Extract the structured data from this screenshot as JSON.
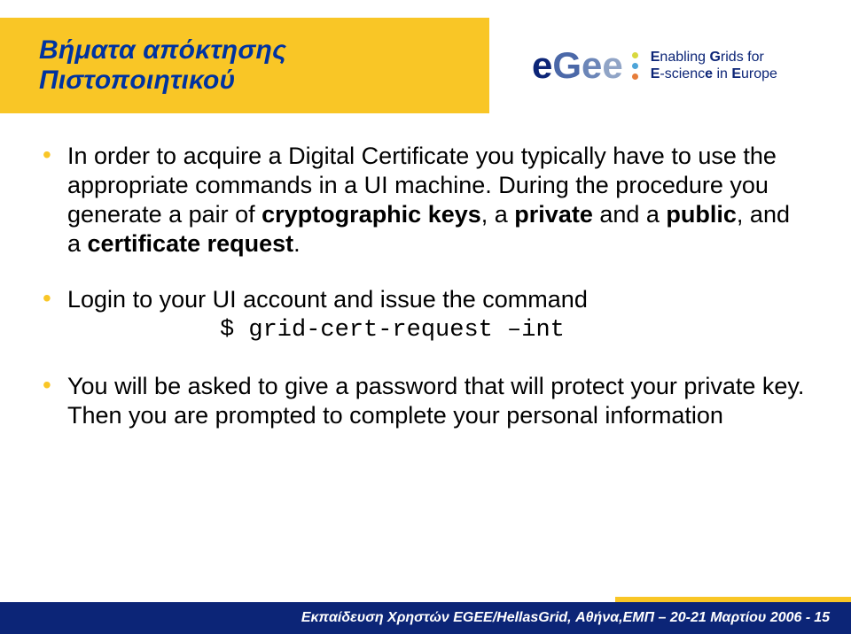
{
  "title": "Βήματα απόκτησης Πιστοποιητικού",
  "logo": {
    "letters": [
      "e",
      "G",
      "e",
      "e"
    ],
    "tagline_bold1": "E",
    "tagline_rest1": "nabling ",
    "tagline_bold2": "G",
    "tagline_rest2": "rids for",
    "tagline_bold3": "E",
    "tagline_rest3": "-scienc",
    "tagline_bold4": "e",
    "tagline_rest4": " in ",
    "tagline_bold5": "E",
    "tagline_rest5": "urope"
  },
  "bullets": {
    "b1_pre": "In order to acquire a Digital Certificate you typically have to use the appropriate commands in a UI machine. During the procedure you generate a pair of ",
    "b1_bold1": "cryptographic keys",
    "b1_mid1": ", a ",
    "b1_bold2": "private",
    "b1_mid2": " and a ",
    "b1_bold3": "public",
    "b1_mid3": ", and a ",
    "b1_bold4": "certificate request",
    "b1_post": ".",
    "b2_text": "Login to your UI account and issue the command",
    "b2_code": "$ grid-cert-request –int",
    "b3_text": "You will be asked to give a password that will protect your private key. Then you are prompted to complete your personal information"
  },
  "footer": {
    "text": "Εκπαίδευση Χρηστών EGEE/HellasGrid, Αθήνα,ΕΜΠ – 20-21 Μαρτίου 2006  - ",
    "page": "15"
  }
}
